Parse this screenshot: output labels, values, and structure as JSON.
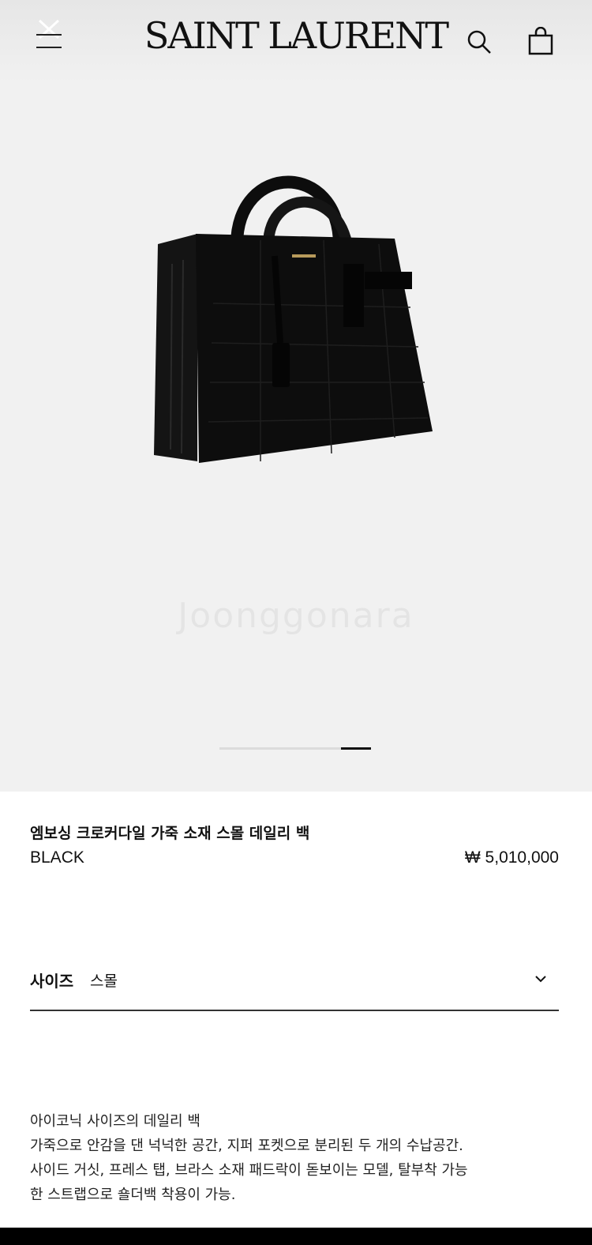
{
  "header": {
    "logo_text": "SAINT LAURENT",
    "menu_icon": "close-menu-icon",
    "search_icon": "search-icon",
    "bag_icon": "shopping-bag-icon"
  },
  "gallery": {
    "watermark": "Joonggonara",
    "slide_count": 2,
    "active_slide": 2
  },
  "product": {
    "name": "엠보싱 크로커다일 가죽 소재 스몰 데일리 백",
    "color": "BLACK",
    "price": "₩ 5,010,000"
  },
  "size": {
    "label": "사이즈",
    "value": "스몰"
  },
  "description": [
    "아이코닉 사이즈의 데일리 백",
    "가죽으로 안감을 댄 넉넉한 공간, 지퍼 포켓으로 분리된 두 개의 수납공간.",
    "사이드 거싯, 프레스 탭, 브라스 소재 패드락이 돋보이는 모델, 탈부착 가능",
    "한 스트랩으로 숄더백 착용이 가능."
  ],
  "colors": {
    "header_bg": "#ececec",
    "hero_bg": "#f1f1f1",
    "text": "#111111",
    "bag": "#0d0d0d"
  }
}
